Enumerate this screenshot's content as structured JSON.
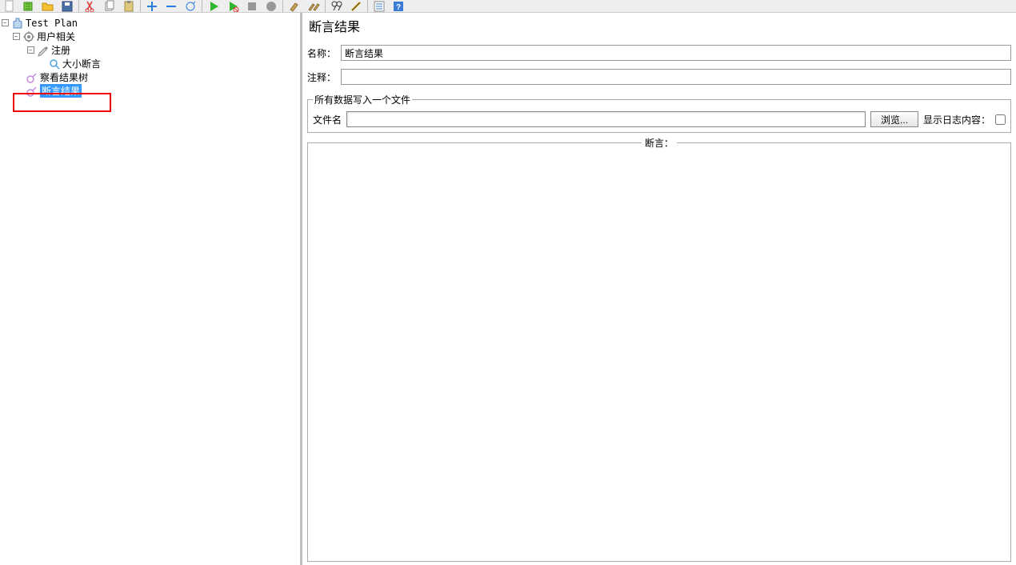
{
  "toolbar": {},
  "tree": {
    "root": {
      "label": "Test Plan",
      "children": [
        {
          "label": "用户相关",
          "children": [
            {
              "label": "注册",
              "children": [
                {
                  "label": "大小断言"
                }
              ]
            },
            {
              "label": "察看结果树"
            },
            {
              "label": "断言结果",
              "selected": true,
              "highlighted": true
            }
          ]
        }
      ]
    }
  },
  "panel": {
    "title": "断言结果",
    "name_label": "名称：",
    "name_value": "断言结果",
    "comment_label": "注释：",
    "comment_value": "",
    "file_group": {
      "legend": "所有数据写入一个文件",
      "filename_label": "文件名",
      "filename_value": "",
      "browse_label": "浏览...",
      "log_label": "显示日志内容："
    },
    "assert_group": {
      "legend": "断言："
    }
  }
}
